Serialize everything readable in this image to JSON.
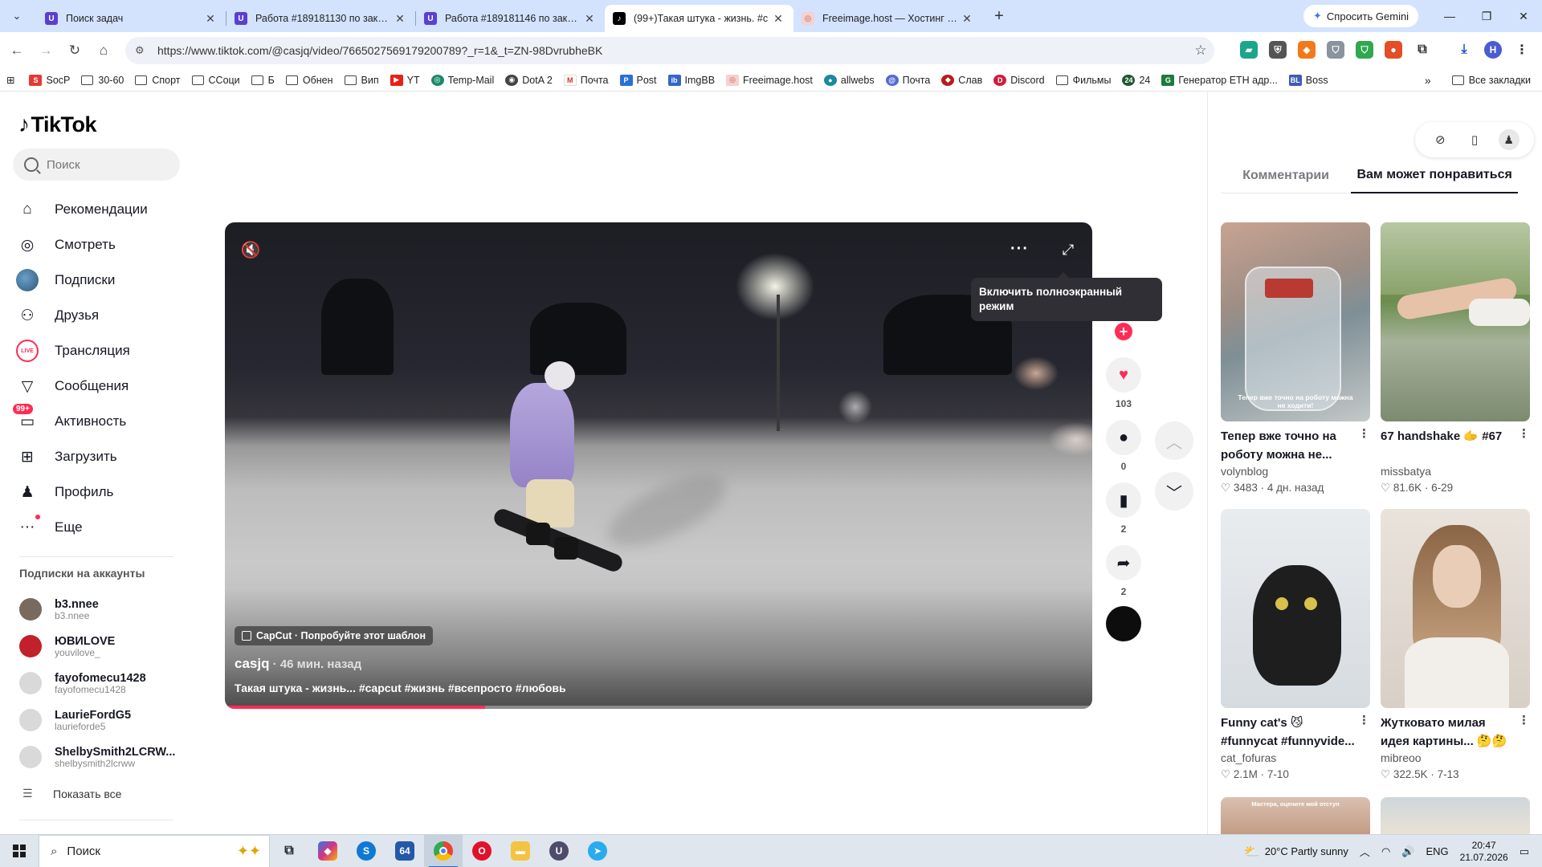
{
  "browser": {
    "tabs": [
      {
        "title": "Поиск задач",
        "favicon": "purple-shield-icon",
        "active": false
      },
      {
        "title": "Работа #189181130 по заказу",
        "favicon": "purple-shield-icon",
        "active": false
      },
      {
        "title": "Работа #189181146 по заказу",
        "favicon": "purple-shield-icon",
        "active": false
      },
      {
        "title": "(99+)Такая штука - жизнь. #c",
        "favicon": "tiktok-icon",
        "active": true
      },
      {
        "title": "Freeimage.host — Хостинг изо",
        "favicon": "freeimage-icon",
        "active": false
      }
    ],
    "gemini_label": "Спросить Gemini",
    "url": "https://www.tiktok.com/@casjq/video/7665027569179200789?_r=1&_t=ZN-98DvrubheBK",
    "profile_letter": "Н",
    "bookmarks": [
      "SocP",
      "30-60",
      "Спорт",
      "ССоци",
      "Б",
      "Обнен",
      "Вип",
      "YT",
      "Temp-Mail",
      "DotA 2",
      "Почта",
      "Post",
      "ImgBB",
      "Freeimage.host",
      "allwebs",
      "Почта",
      "Слав",
      "Discord",
      "Фильмы",
      "24",
      "Генератор ETH адр...",
      "Boss"
    ],
    "all_bookmarks": "Все закладки"
  },
  "tiktok": {
    "logo": "TikTok",
    "search_placeholder": "Поиск",
    "nav": [
      {
        "label": "Рекомендации",
        "icon": "home-icon"
      },
      {
        "label": "Смотреть",
        "icon": "compass-icon"
      },
      {
        "label": "Подписки",
        "icon": "following-avatar-icon"
      },
      {
        "label": "Друзья",
        "icon": "friends-icon"
      },
      {
        "label": "Трансляция",
        "icon": "live-icon"
      },
      {
        "label": "Сообщения",
        "icon": "messages-icon"
      },
      {
        "label": "Активность",
        "icon": "activity-icon",
        "badge": "99+"
      },
      {
        "label": "Загрузить",
        "icon": "upload-icon"
      },
      {
        "label": "Профиль",
        "icon": "profile-avatar-icon"
      },
      {
        "label": "Еще",
        "icon": "more-icon"
      }
    ],
    "live_icon_text": "LIVE",
    "subs_title": "Подписки на аккаунты",
    "subscriptions": [
      {
        "name": "b3.nnee",
        "handle": "b3.nnee",
        "color": "#7a6a5e"
      },
      {
        "name": "ЮВИLOVE",
        "handle": "youvilove_",
        "color": "#c2202a"
      },
      {
        "name": "fayofomecu1428",
        "handle": "fayofomecu1428",
        "color": "#d9d9d9"
      },
      {
        "name": "LaurieFordG5",
        "handle": "laurieforde5",
        "color": "#d9d9d9"
      },
      {
        "name": "ShelbySmith2LCRW...",
        "handle": "shelbysmith2lcrww",
        "color": "#d9d9d9"
      }
    ],
    "show_all": "Показать все",
    "video": {
      "capcut": "CapCut · Попробуйте этот шаблон",
      "author": "casjq",
      "time": " · 46 мин. назад",
      "caption": "Такая штука - жизнь... #capcut #жизнь #всепросто #любовь",
      "progress": 0.3,
      "more_glyph": "···",
      "tooltip": "Включить полноэкранный режим"
    },
    "actions": {
      "likes": "103",
      "comments": "0",
      "saves": "2",
      "shares": "2"
    },
    "right_tabs": [
      "Комментарии",
      "Вам может понравиться"
    ],
    "recommended": [
      {
        "title": "Тепер вже точно на роботу можна не...",
        "author": "volynblog",
        "likes": "3483",
        "date": "4 дн. назад",
        "overlay": "Тепер вже точно на роботу можна не ходити!"
      },
      {
        "title": "67 handshake 🫱 #67",
        "author": "missbatya",
        "likes": "81.6K",
        "date": "6-29"
      },
      {
        "title": "Funny cat's 😼 #funnycat #funnyvide...",
        "author": "cat_fofuras",
        "likes": "2.1M",
        "date": "7-10"
      },
      {
        "title": "Жутковато милая идея картины... 🤔🤔🤔",
        "author": "mibreoo",
        "likes": "322.5K",
        "date": "7-13"
      }
    ],
    "next_card_overlay": "Мастера, оцените мой отступ"
  },
  "taskbar": {
    "search_label": "Поиск",
    "weather": "20°C  Partly sunny",
    "lang": "ENG",
    "time": "20:47",
    "date": "21.07.2026"
  },
  "colors": {
    "accent": "#fe2c55",
    "tabstrip": "#d3e3fd"
  }
}
